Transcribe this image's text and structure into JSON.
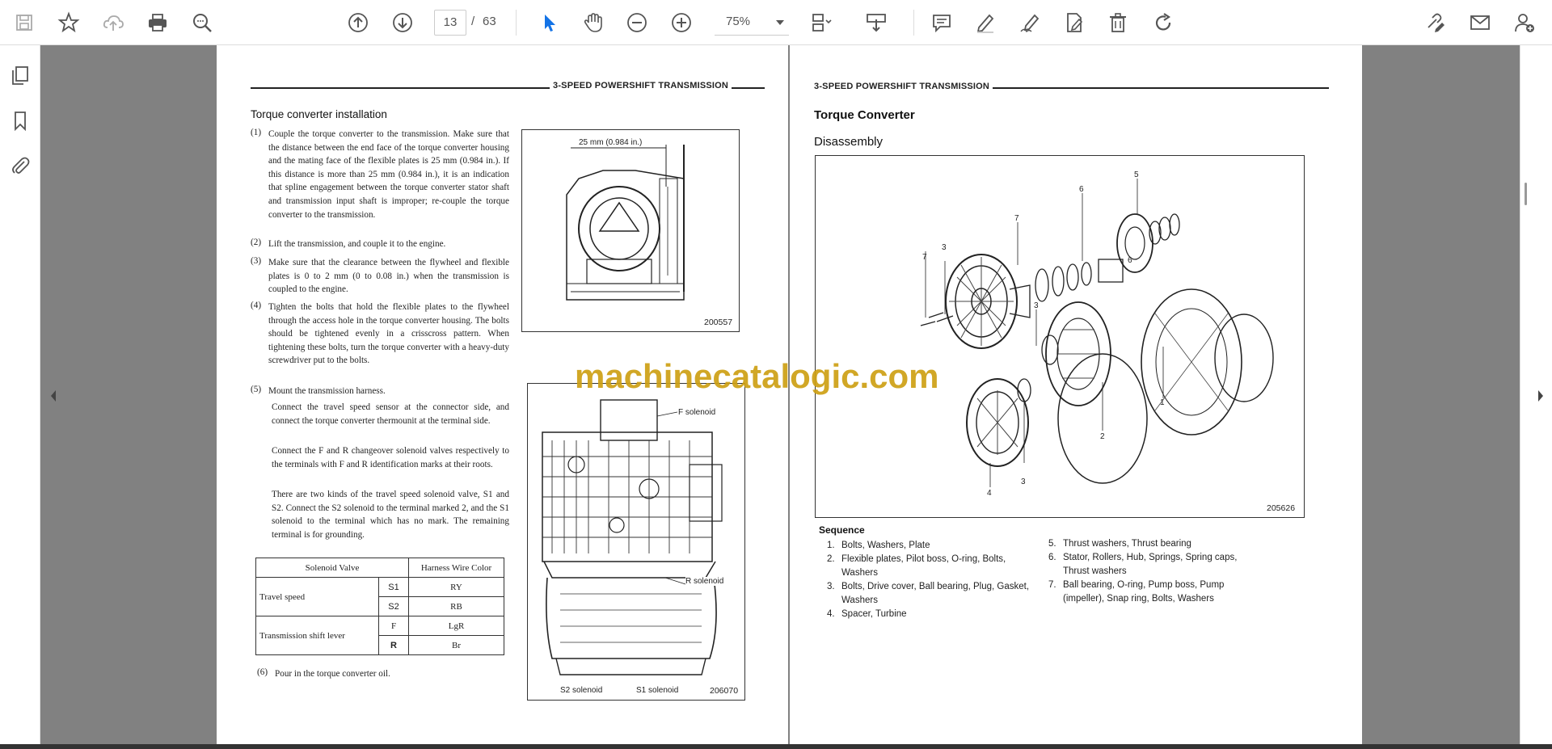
{
  "toolbar": {
    "page_current": "13",
    "page_sep": "/",
    "page_total": "63",
    "zoom": "75%"
  },
  "left_page": {
    "header": "3-SPEED  POWERSHIFT TRANSMISSION",
    "section_title": "Torque converter installation",
    "steps": [
      {
        "num": "(1)",
        "text": "Couple the torque converter to the transmission. Make sure that the distance between the end face of the torque converter housing and the mating face of the flexible plates is 25 mm (0.984 in.). If this distance is more than 25 mm (0.984 in.), it is an indication that spline engagement between the torque converter stator shaft and transmission input shaft is improper; re-couple the torque converter to the transmission."
      },
      {
        "num": "(2)",
        "text": "Lift the transmission, and couple it to the engine."
      },
      {
        "num": "(3)",
        "text": "Make sure that the clearance between the flywheel and flexible plates is 0 to 2 mm (0 to 0.08 in.) when the transmission is coupled to the engine."
      },
      {
        "num": "(4)",
        "text": "Tighten the bolts that hold the flexible plates to the flywheel through the access hole in the torque converter housing. The bolts should be tightened evenly in a crisscross pattern. When tightening these bolts, turn the torque converter with a heavy-duty screwdriver put to the bolts."
      },
      {
        "num": "(5)",
        "text": "Mount the transmission harness."
      }
    ],
    "sub_paras": [
      "Connect the travel speed sensor at the connector side, and connect the torque converter thermounit at the terminal side.",
      "Connect the F and R changeover solenoid valves respectively to the terminals with F and R identification marks at their roots.",
      "There are two kinds of the travel speed solenoid valve, S1 and S2. Connect the S2 solenoid to the terminal marked 2, and the S1 solenoid to the terminal which has no mark. The remaining terminal is for grounding."
    ],
    "step6": {
      "num": "(6)",
      "text": "Pour in the torque converter oil."
    },
    "fig1": {
      "dimension": "25 mm (0.984 in.)",
      "code": "200557"
    },
    "fig2": {
      "f_solenoid": "F solenoid",
      "r_solenoid": "R solenoid",
      "s2_solenoid": "S2 solenoid",
      "s1_solenoid": "S1 solenoid",
      "code": "206070"
    },
    "table": {
      "header_valve": "Solenoid Valve",
      "header_color": "Harness Wire Color",
      "travel_speed": "Travel speed",
      "shift_lever": "Transmission shift lever",
      "rows": [
        {
          "code": "S1",
          "color": "RY"
        },
        {
          "code": "S2",
          "color": "RB"
        },
        {
          "code": "F",
          "color": "LgR"
        },
        {
          "code": "R",
          "color": "Br"
        }
      ]
    }
  },
  "right_page": {
    "header": "3-SPEED  POWERSHIFT TRANSMISSION",
    "title": "Torque Converter",
    "subtitle": "Disassembly",
    "fig_code": "205626",
    "callouts": [
      "5",
      "6",
      "7",
      "6",
      "7",
      "3",
      "3",
      "1",
      "2",
      "4",
      "3"
    ],
    "sequence_title": "Sequence",
    "sequence": [
      {
        "n": "1.",
        "t": "Bolts, Washers, Plate"
      },
      {
        "n": "2.",
        "t": "Flexible plates, Pilot boss, O-ring, Bolts, Washers"
      },
      {
        "n": "3.",
        "t": "Bolts, Drive cover, Ball bearing, Plug, Gasket, Washers"
      },
      {
        "n": "4.",
        "t": "Spacer, Turbine"
      },
      {
        "n": "5.",
        "t": "Thrust washers, Thrust bearing"
      },
      {
        "n": "6.",
        "t": "Stator, Rollers, Hub, Springs, Spring caps, Thrust washers"
      },
      {
        "n": "7.",
        "t": "Ball bearing, O-ring, Pump boss, Pump (impeller), Snap ring, Bolts, Washers"
      }
    ]
  },
  "watermark": "machinecatalogic.com",
  "colors": {
    "accent": "#1473e6",
    "viewer_bg": "#818181",
    "watermark": "#cda014"
  }
}
